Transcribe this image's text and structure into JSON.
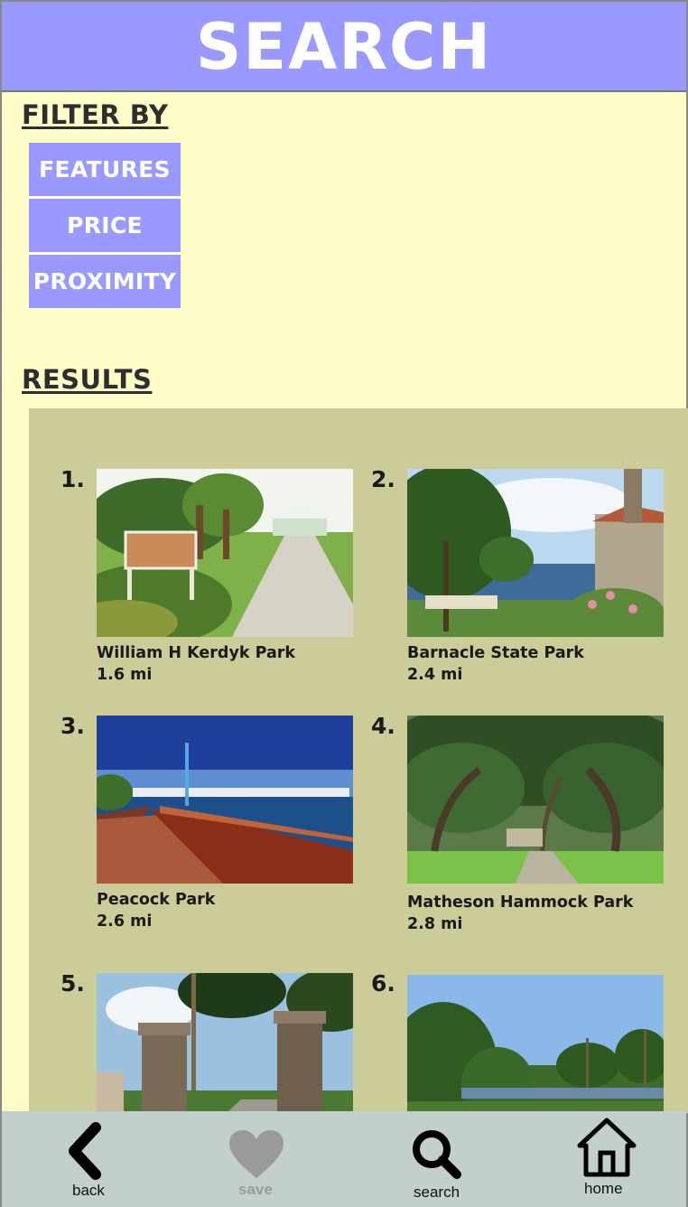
{
  "header": {
    "title": "SEARCH"
  },
  "filters": {
    "title": "FILTER BY",
    "buttons": [
      "FEATURES",
      "PRICE",
      "PROXIMITY"
    ]
  },
  "results": {
    "title": "RESULTS",
    "items": [
      {
        "num": "1.",
        "name": "William H Kerdyk Park",
        "distance": "1.6 mi"
      },
      {
        "num": "2.",
        "name": "Barnacle State Park",
        "distance": "2.4 mi"
      },
      {
        "num": "3.",
        "name": "Peacock Park",
        "distance": "2.6 mi"
      },
      {
        "num": "4.",
        "name": "Matheson Hammock Park",
        "distance": "2.8 mi"
      },
      {
        "num": "5.",
        "name": "",
        "distance": ""
      },
      {
        "num": "6.",
        "name": "",
        "distance": ""
      }
    ]
  },
  "nav": {
    "back": "back",
    "save": "save",
    "search": "search",
    "home": "home"
  },
  "colors": {
    "accent": "#9999ff",
    "background": "#fffdc8",
    "results_panel": "#cccc99",
    "nav_bar": "#c2cfcb"
  },
  "icons": {
    "back": "chevron-left-icon",
    "save": "heart-icon",
    "search": "magnifier-icon",
    "home": "house-icon"
  }
}
